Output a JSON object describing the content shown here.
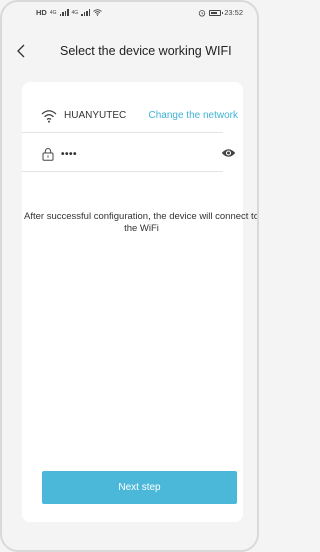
{
  "status_bar": {
    "left_label": "HD",
    "network_1": "4G",
    "network_2": "4G",
    "battery_label": "68",
    "time": "23:52"
  },
  "header": {
    "back_icon": "chevron-left-icon",
    "title": "Select the device working WIFI"
  },
  "wifi": {
    "icon": "wifi-icon",
    "ssid": "HUANYUTEC",
    "change_label": "Change the network"
  },
  "password": {
    "icon": "lock-icon",
    "value": "••••",
    "toggle_icon": "eye-icon"
  },
  "hint": "After successful configuration, the device will connect to the WiFi",
  "next_button": {
    "label": "Next step",
    "color": "#4cb8d9"
  },
  "colors": {
    "accent": "#3fb3d6",
    "background": "#f4f4f4",
    "card": "#ffffff"
  }
}
